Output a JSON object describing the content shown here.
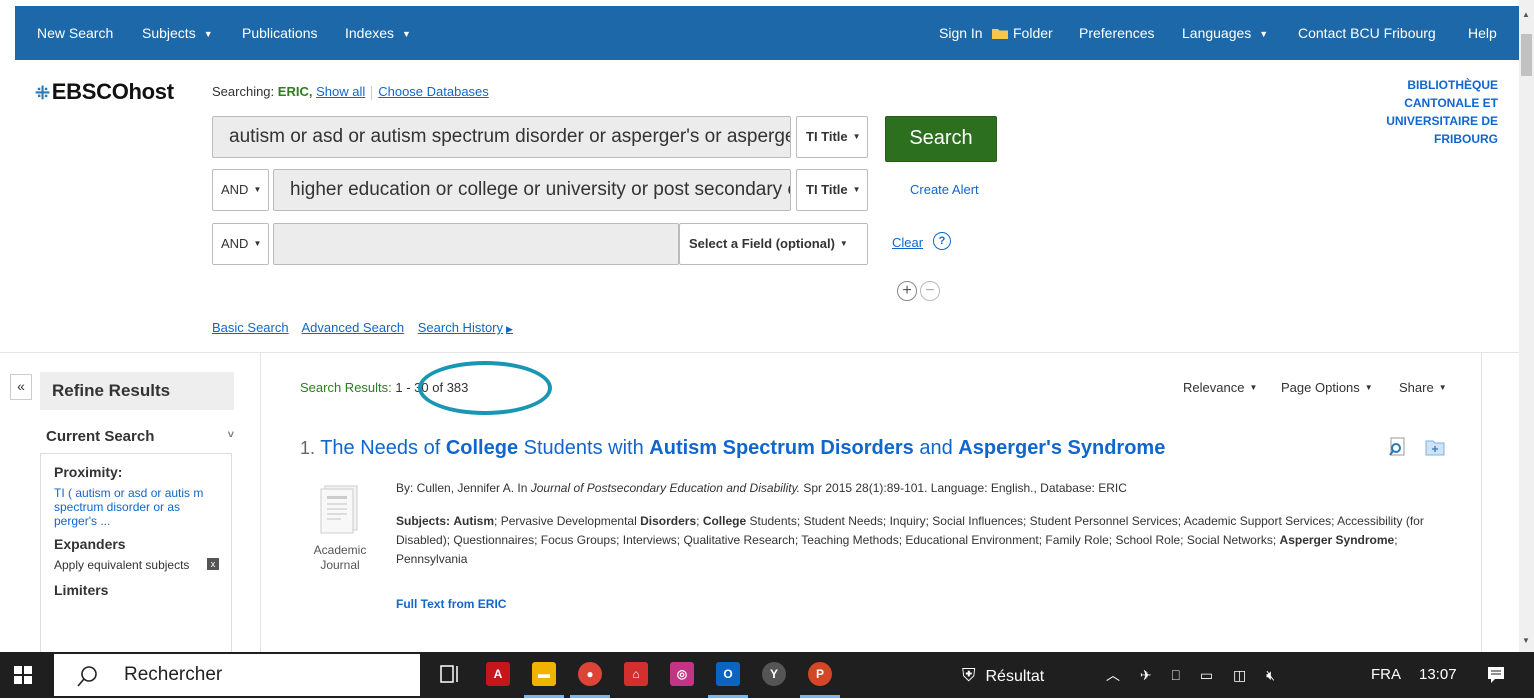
{
  "topnav": {
    "new_search": "New Search",
    "subjects": "Subjects",
    "publications": "Publications",
    "indexes": "Indexes",
    "sign_in": "Sign In",
    "folder": "Folder",
    "preferences": "Preferences",
    "languages": "Languages",
    "contact": "Contact BCU Fribourg",
    "help": "Help"
  },
  "header": {
    "logo": "EBSCOhost",
    "searching_label": "Searching:",
    "database": "ERIC,",
    "show_all": "Show all",
    "choose_databases": "Choose Databases",
    "institution": "BIBLIOTHÈQUE CANTONALE ET UNIVERSITAIRE DE FRIBOURG"
  },
  "search": {
    "row1_query": "autism or asd or autism spectrum disorder or asperger's or asperger's syndrome",
    "row1_field": "TI Title",
    "row2_bool": "AND",
    "row2_query": "higher education or college or university or post secondary education",
    "row2_field": "TI Title",
    "row3_bool": "AND",
    "row3_query": "",
    "row3_field": "Select a Field (optional)",
    "search_button": "Search",
    "create_alert": "Create Alert",
    "clear": "Clear",
    "help_glyph": "?",
    "add_row_glyph": "+",
    "remove_row_glyph": "−",
    "links": {
      "basic": "Basic Search",
      "advanced": "Advanced Search",
      "history": "Search History"
    }
  },
  "refine": {
    "collapse_glyph": "«",
    "title": "Refine Results",
    "current_search": "Current Search",
    "proximity_title": "Proximity:",
    "proximity_value": "TI ( autism or asd or autis m spectrum disorder or as perger's ...",
    "expanders_title": "Expanders",
    "apply_equivalent": "Apply equivalent subjects",
    "remove_glyph": "x",
    "limiters_title": "Limiters"
  },
  "results": {
    "label": "Search Results:",
    "range": "1 - 30 of 383",
    "sort": "Relevance",
    "page_options": "Page Options",
    "share": "Share",
    "items": [
      {
        "number": "1.",
        "title_parts": [
          "The Needs of ",
          "College",
          " Students with ",
          "Autism Spectrum Disorders",
          " and ",
          "Asperger's Syndrome"
        ],
        "by": "By: Cullen, Jennifer A. In ",
        "journal": "Journal of Postsecondary Education and Disability.",
        "citation": " Spr 2015 28(1):89-101. Language: English., Database: ERIC",
        "subjects_label": "Subjects:",
        "subjects_html_parts": [
          [
            "Autism",
            true
          ],
          [
            "; Pervasive Developmental ",
            false
          ],
          [
            "Disorders",
            true
          ],
          [
            "; ",
            false
          ],
          [
            "College",
            true
          ],
          [
            " Students; Student Needs; Inquiry; Social Influences; Student Personnel Services; Academic Support Services; Accessibility (for Disabled); Questionnaires; Focus Groups; Interviews; Qualitative Research; Teaching Methods; Educational Environment; Family Role; School Role; Social Networks; ",
            false
          ],
          [
            "Asperger Syndrome",
            true
          ],
          [
            "; Pennsylvania",
            false
          ]
        ],
        "publication_type": "Academic Journal",
        "full_text": "Full Text from ERIC"
      }
    ]
  },
  "taskbar": {
    "search_placeholder": "Rechercher",
    "active_app": "Résultat",
    "language": "FRA",
    "time": "13:07"
  },
  "colors": {
    "nav": "#1c68a8",
    "link": "#1166cc",
    "search_button": "#2c6f1e",
    "highlight_ring": "#1896b4"
  }
}
